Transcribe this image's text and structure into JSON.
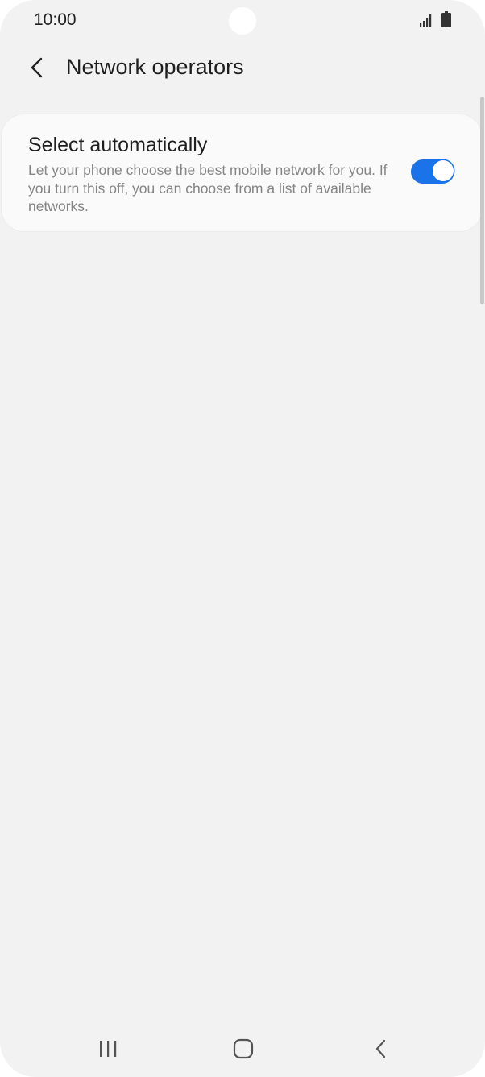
{
  "status_bar": {
    "time": "10:00",
    "icons": [
      "signal-icon",
      "battery-icon"
    ]
  },
  "app_bar": {
    "back_icon": "chevron-left-icon",
    "title": "Network operators"
  },
  "settings": {
    "select_automatically": {
      "title": "Select automatically",
      "description": "Let your phone choose the best mobile network for you. If you turn this off, you can choose from a list of available networks.",
      "enabled": true
    }
  },
  "nav_bar": {
    "items": [
      "recent-apps-icon",
      "home-icon",
      "back-icon"
    ]
  },
  "colors": {
    "background": "#f2f2f2",
    "card": "#fafafa",
    "accent": "#1a73e8",
    "secondary_text": "#858585"
  }
}
